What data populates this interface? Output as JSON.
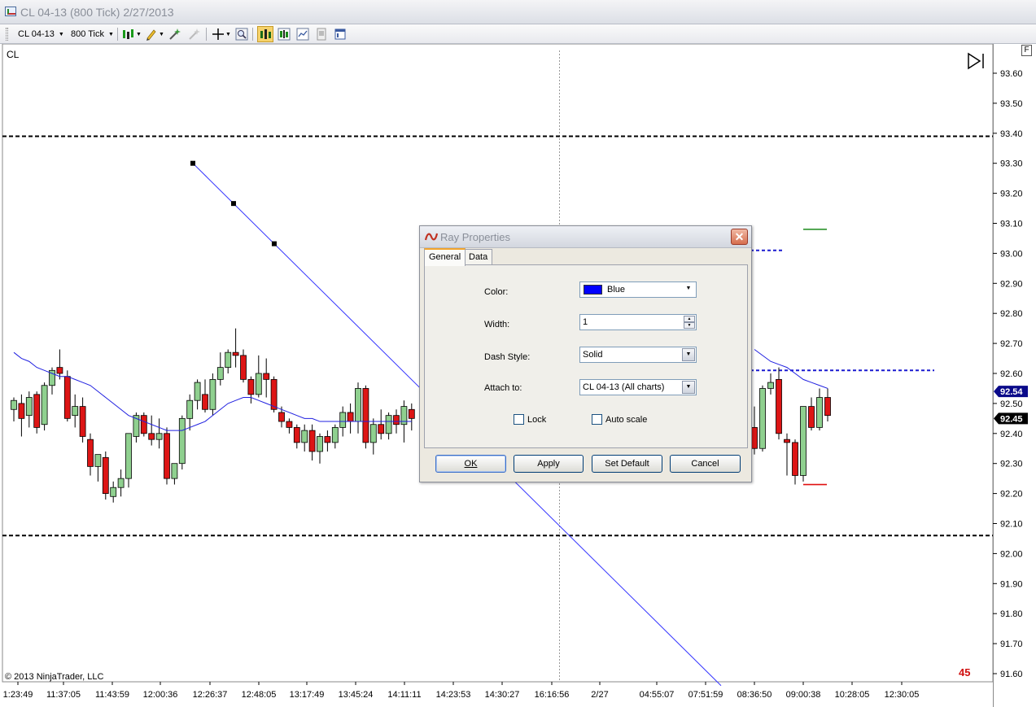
{
  "window": {
    "title": "CL 04-13 (800 Tick)  2/27/2013"
  },
  "toolbar": {
    "instrument": "CL 04-13",
    "interval": "800 Tick"
  },
  "chart": {
    "symbol": "CL",
    "copyright": "© 2013 NinjaTrader, LLC",
    "bar_count": "45",
    "f_label": "F",
    "up_color": "#8fd08f",
    "down_color": "#dd1515",
    "ma_color": "#2020e0",
    "ray_color": "#3333ff"
  },
  "chart_data": {
    "type": "candlestick",
    "y_ticks": [
      "93.60",
      "93.50",
      "93.40",
      "93.30",
      "93.20",
      "93.10",
      "93.00",
      "92.90",
      "92.80",
      "92.70",
      "92.60",
      "92.50",
      "92.40",
      "92.30",
      "92.20",
      "92.10",
      "92.00",
      "91.90",
      "91.80",
      "91.70",
      "91.60"
    ],
    "x_ticks": [
      "1:23:49",
      "11:37:05",
      "11:43:59",
      "12:00:36",
      "12:26:37",
      "12:48:05",
      "13:17:49",
      "13:45:24",
      "14:11:11",
      "14:23:53",
      "14:30:27",
      "16:16:56",
      "2/27",
      "04:55:07",
      "07:51:59",
      "08:36:50",
      "09:00:38",
      "10:28:05",
      "12:30:05"
    ],
    "price_flags": [
      {
        "label": "92.54",
        "value": 92.54,
        "color": "#0a0a8a"
      },
      {
        "label": "92.45",
        "value": 92.45,
        "color": "#000000"
      }
    ],
    "horizontal_lines": [
      {
        "value": 93.39,
        "color": "#000000",
        "style": "dashed"
      },
      {
        "value": 92.06,
        "color": "#000000",
        "style": "dashed"
      },
      {
        "value": 93.01,
        "color": "#1a1ad0",
        "style": "dashed"
      },
      {
        "value": 92.61,
        "color": "#1a1ad0",
        "style": "dashed"
      },
      {
        "value": 93.08,
        "color": "#1a8a1a",
        "style": "solid"
      },
      {
        "value": 92.23,
        "color": "#e01010",
        "style": "solid"
      }
    ],
    "candles": [
      {
        "o": 92.48,
        "h": 92.52,
        "l": 92.44,
        "c": 92.51
      },
      {
        "o": 92.5,
        "h": 92.53,
        "l": 92.39,
        "c": 92.45
      },
      {
        "o": 92.46,
        "h": 92.54,
        "l": 92.42,
        "c": 92.52
      },
      {
        "o": 92.53,
        "h": 92.54,
        "l": 92.4,
        "c": 92.42
      },
      {
        "o": 92.43,
        "h": 92.57,
        "l": 92.41,
        "c": 92.56
      },
      {
        "o": 92.56,
        "h": 92.62,
        "l": 92.53,
        "c": 92.61
      },
      {
        "o": 92.62,
        "h": 92.68,
        "l": 92.58,
        "c": 92.6
      },
      {
        "o": 92.59,
        "h": 92.61,
        "l": 92.44,
        "c": 92.45
      },
      {
        "o": 92.46,
        "h": 92.53,
        "l": 92.42,
        "c": 92.49
      },
      {
        "o": 92.49,
        "h": 92.52,
        "l": 92.37,
        "c": 92.39
      },
      {
        "o": 92.38,
        "h": 92.4,
        "l": 92.26,
        "c": 92.29
      },
      {
        "o": 92.29,
        "h": 92.33,
        "l": 92.24,
        "c": 92.33
      },
      {
        "o": 92.32,
        "h": 92.34,
        "l": 92.18,
        "c": 92.2
      },
      {
        "o": 92.19,
        "h": 92.24,
        "l": 92.17,
        "c": 92.22
      },
      {
        "o": 92.22,
        "h": 92.28,
        "l": 92.19,
        "c": 92.25
      },
      {
        "o": 92.25,
        "h": 92.4,
        "l": 92.22,
        "c": 92.4
      },
      {
        "o": 92.39,
        "h": 92.47,
        "l": 92.37,
        "c": 92.46
      },
      {
        "o": 92.46,
        "h": 92.47,
        "l": 92.39,
        "c": 92.4
      },
      {
        "o": 92.4,
        "h": 92.46,
        "l": 92.36,
        "c": 92.38
      },
      {
        "o": 92.38,
        "h": 92.45,
        "l": 92.35,
        "c": 92.4
      },
      {
        "o": 92.4,
        "h": 92.42,
        "l": 92.23,
        "c": 92.25
      },
      {
        "o": 92.25,
        "h": 92.3,
        "l": 92.23,
        "c": 92.3
      },
      {
        "o": 92.3,
        "h": 92.46,
        "l": 92.28,
        "c": 92.45
      },
      {
        "o": 92.45,
        "h": 92.53,
        "l": 92.41,
        "c": 92.51
      },
      {
        "o": 92.51,
        "h": 92.58,
        "l": 92.48,
        "c": 92.57
      },
      {
        "o": 92.53,
        "h": 92.58,
        "l": 92.47,
        "c": 92.48
      },
      {
        "o": 92.48,
        "h": 92.6,
        "l": 92.46,
        "c": 92.58
      },
      {
        "o": 92.58,
        "h": 92.67,
        "l": 92.56,
        "c": 92.62
      },
      {
        "o": 92.62,
        "h": 92.68,
        "l": 92.6,
        "c": 92.67
      },
      {
        "o": 92.67,
        "h": 92.75,
        "l": 92.62,
        "c": 92.66
      },
      {
        "o": 92.66,
        "h": 92.68,
        "l": 92.57,
        "c": 92.58
      },
      {
        "o": 92.58,
        "h": 92.59,
        "l": 92.5,
        "c": 92.53
      },
      {
        "o": 92.53,
        "h": 92.66,
        "l": 92.52,
        "c": 92.6
      },
      {
        "o": 92.6,
        "h": 92.65,
        "l": 92.52,
        "c": 92.58
      },
      {
        "o": 92.58,
        "h": 92.59,
        "l": 92.47,
        "c": 92.48
      },
      {
        "o": 92.47,
        "h": 92.49,
        "l": 92.42,
        "c": 92.44
      },
      {
        "o": 92.44,
        "h": 92.45,
        "l": 92.4,
        "c": 92.42
      },
      {
        "o": 92.42,
        "h": 92.43,
        "l": 92.35,
        "c": 92.37
      },
      {
        "o": 92.37,
        "h": 92.43,
        "l": 92.34,
        "c": 92.41
      },
      {
        "o": 92.41,
        "h": 92.43,
        "l": 92.31,
        "c": 92.34
      },
      {
        "o": 92.34,
        "h": 92.4,
        "l": 92.3,
        "c": 92.39
      },
      {
        "o": 92.39,
        "h": 92.41,
        "l": 92.34,
        "c": 92.37
      },
      {
        "o": 92.37,
        "h": 92.43,
        "l": 92.35,
        "c": 92.42
      },
      {
        "o": 92.42,
        "h": 92.49,
        "l": 92.39,
        "c": 92.47
      },
      {
        "o": 92.47,
        "h": 92.5,
        "l": 92.4,
        "c": 92.44
      },
      {
        "o": 92.44,
        "h": 92.57,
        "l": 92.4,
        "c": 92.55
      },
      {
        "o": 92.55,
        "h": 92.56,
        "l": 92.35,
        "c": 92.37
      },
      {
        "o": 92.37,
        "h": 92.45,
        "l": 92.33,
        "c": 92.43
      },
      {
        "o": 92.43,
        "h": 92.48,
        "l": 92.38,
        "c": 92.4
      },
      {
        "o": 92.4,
        "h": 92.47,
        "l": 92.38,
        "c": 92.46
      },
      {
        "o": 92.46,
        "h": 92.48,
        "l": 92.4,
        "c": 92.43
      },
      {
        "o": 92.43,
        "h": 92.51,
        "l": 92.37,
        "c": 92.49
      },
      {
        "o": 92.48,
        "h": 92.5,
        "l": 92.41,
        "c": 92.45
      }
    ],
    "candles_right": [
      {
        "o": 92.42,
        "h": 92.49,
        "l": 92.33,
        "c": 92.35
      },
      {
        "o": 92.35,
        "h": 92.56,
        "l": 92.34,
        "c": 92.55
      },
      {
        "o": 92.55,
        "h": 92.6,
        "l": 92.53,
        "c": 92.57
      },
      {
        "o": 92.58,
        "h": 92.62,
        "l": 92.38,
        "c": 92.4
      },
      {
        "o": 92.38,
        "h": 92.4,
        "l": 92.26,
        "c": 92.37
      },
      {
        "o": 92.37,
        "h": 92.38,
        "l": 92.23,
        "c": 92.26
      },
      {
        "o": 92.26,
        "h": 92.49,
        "l": 92.24,
        "c": 92.49
      },
      {
        "o": 92.49,
        "h": 92.52,
        "l": 92.41,
        "c": 92.42
      },
      {
        "o": 92.42,
        "h": 92.55,
        "l": 92.41,
        "c": 92.52
      },
      {
        "o": 92.52,
        "h": 92.55,
        "l": 92.44,
        "c": 92.46
      }
    ],
    "moving_average": [
      92.67,
      92.65,
      92.64,
      92.62,
      92.61,
      92.6,
      92.59,
      92.59,
      92.58,
      92.57,
      92.56,
      92.54,
      92.52,
      92.5,
      92.48,
      92.46,
      92.45,
      92.44,
      92.43,
      92.42,
      92.41,
      92.41,
      92.41,
      92.42,
      92.43,
      92.44,
      92.46,
      92.48,
      92.5,
      92.51,
      92.52,
      92.52,
      92.51,
      92.5,
      92.49,
      92.48,
      92.47,
      92.46,
      92.45,
      92.45,
      92.44,
      92.44,
      92.44,
      92.44,
      92.44,
      92.44,
      92.44,
      92.44,
      92.44,
      92.44,
      92.44,
      92.44,
      92.44
    ],
    "moving_average_right": [
      92.68,
      92.66,
      92.64,
      92.63,
      92.62,
      92.6,
      92.58,
      92.57,
      92.56,
      92.55
    ],
    "ray": {
      "start": 93.3,
      "end": 91.56
    }
  },
  "dialog": {
    "title": "Ray Properties",
    "tabs": [
      {
        "label": "General"
      },
      {
        "label": "Data"
      }
    ],
    "color_label": "Color:",
    "color_value": "Blue",
    "color_swatch": "#0000ff",
    "width_label": "Width:",
    "width_value": "1",
    "dash_label": "Dash Style:",
    "dash_value": "Solid",
    "attach_label": "Attach to:",
    "attach_value": "CL 04-13 (All charts)",
    "lock_label": "Lock",
    "autoscale_label": "Auto scale",
    "buttons": {
      "ok": "OK",
      "apply": "Apply",
      "set_default": "Set Default",
      "cancel": "Cancel"
    }
  }
}
